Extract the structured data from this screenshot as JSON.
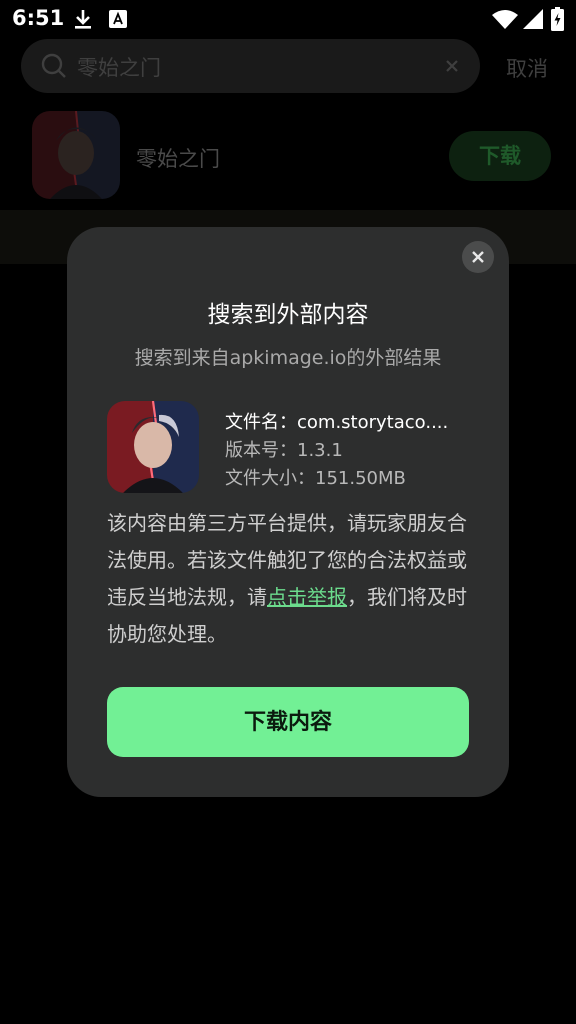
{
  "status_bar": {
    "time": "6:51",
    "icons": [
      "download-icon",
      "font-a-icon",
      "wifi-icon",
      "cellular-icon",
      "battery-icon"
    ]
  },
  "search": {
    "value": "零始之门",
    "cancel_label": "取消"
  },
  "result": {
    "title": "零始之门",
    "download_label": "下载"
  },
  "dialog": {
    "title": "搜索到外部内容",
    "subtitle": "搜索到来自apkimage.io的外部结果",
    "file_name": "文件名：com.storytaco....",
    "version": "版本号：1.3.1",
    "file_size": "文件大小：151.50MB",
    "notice_before": "该内容由第三方平台提供，请玩家朋友合法使用。若该文件触犯了您的合法权益或违反当地法规，请",
    "notice_link": "点击举报",
    "notice_after": "，我们将及时协助您处理。",
    "primary_button": "下载内容"
  },
  "colors": {
    "accent": "#72f095",
    "dialog_bg": "#2d2e2e",
    "link": "#6cdc8d"
  }
}
